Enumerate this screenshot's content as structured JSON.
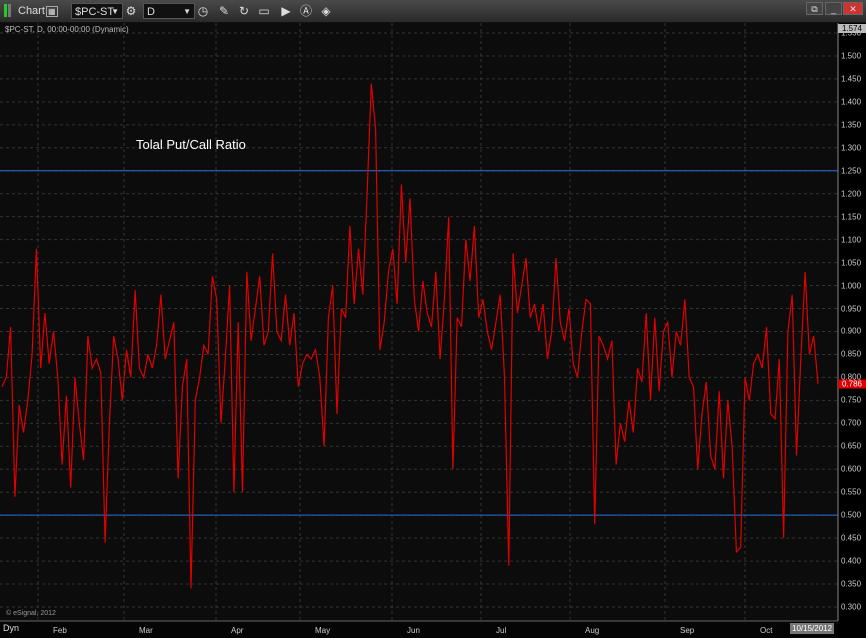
{
  "window": {
    "title": "Chart",
    "symbol": "$PC-ST",
    "interval": "D"
  },
  "legend": "$PC-ST, D, 00:00-00:00 (Dynamic)",
  "copyright": "© eSignal, 2012",
  "dyn_label": "Dyn",
  "colors": {
    "line": "#e00000",
    "hline": "#2b6fd6",
    "bg": "#0c0c0c"
  },
  "chart_data": {
    "type": "line",
    "title": "Tolal Put/Call Ratio",
    "xlabel": "",
    "ylabel": "",
    "ylim": [
      0.3,
      1.55
    ],
    "yticks": [
      "1.550",
      "1.500",
      "1.450",
      "1.400",
      "1.350",
      "1.300",
      "1.250",
      "1.200",
      "1.150",
      "1.100",
      "1.050",
      "1.000",
      "0.950",
      "0.900",
      "0.850",
      "0.800",
      "0.750",
      "0.700",
      "0.650",
      "0.600",
      "0.550",
      "0.500",
      "0.450",
      "0.400",
      "0.350",
      "0.300"
    ],
    "xticks": [
      "Feb",
      "Mar",
      "Apr",
      "May",
      "Jun",
      "Jul",
      "Aug",
      "Sep",
      "Oct"
    ],
    "current_date": "10/15/2012",
    "top_value": "1.574",
    "last_value": "0.786",
    "hlines": [
      1.25,
      0.5
    ],
    "series": [
      {
        "name": "$PC-ST",
        "values": [
          0.78,
          0.8,
          0.91,
          0.54,
          0.74,
          0.68,
          0.75,
          0.85,
          1.08,
          0.82,
          0.94,
          0.83,
          0.9,
          0.8,
          0.61,
          0.76,
          0.56,
          0.8,
          0.7,
          0.62,
          0.89,
          0.82,
          0.84,
          0.81,
          0.44,
          0.7,
          0.89,
          0.84,
          0.75,
          0.86,
          0.8,
          0.99,
          0.82,
          0.8,
          0.85,
          0.82,
          0.87,
          0.98,
          0.84,
          0.88,
          0.92,
          0.58,
          0.78,
          0.84,
          0.34,
          0.75,
          0.8,
          0.87,
          0.85,
          1.02,
          0.97,
          0.7,
          0.84,
          1.0,
          0.55,
          0.92,
          0.55,
          1.03,
          0.88,
          0.95,
          1.02,
          0.87,
          0.9,
          1.07,
          0.9,
          0.88,
          0.98,
          0.87,
          0.94,
          0.78,
          0.83,
          0.85,
          0.84,
          0.86,
          0.8,
          0.65,
          0.93,
          1.0,
          0.72,
          0.95,
          0.93,
          1.13,
          0.96,
          1.08,
          0.98,
          1.2,
          1.44,
          1.34,
          0.86,
          0.92,
          1.03,
          1.08,
          0.96,
          1.22,
          1.05,
          1.19,
          0.97,
          0.9,
          1.01,
          0.94,
          0.91,
          1.03,
          0.84,
          0.97,
          1.15,
          0.6,
          0.93,
          0.91,
          1.1,
          1.01,
          1.13,
          0.93,
          0.97,
          0.9,
          0.86,
          0.92,
          0.98,
          0.8,
          0.39,
          1.07,
          0.94,
          1.0,
          1.06,
          0.93,
          0.96,
          0.9,
          0.96,
          0.84,
          0.9,
          1.06,
          0.92,
          0.88,
          0.95,
          0.83,
          0.8,
          0.9,
          0.97,
          0.96,
          0.48,
          0.89,
          0.87,
          0.84,
          0.88,
          0.61,
          0.7,
          0.66,
          0.75,
          0.68,
          0.82,
          0.79,
          0.94,
          0.75,
          0.93,
          0.77,
          0.9,
          0.92,
          0.8,
          0.9,
          0.87,
          0.97,
          0.8,
          0.78,
          0.6,
          0.72,
          0.79,
          0.63,
          0.6,
          0.77,
          0.58,
          0.75,
          0.65,
          0.42,
          0.43,
          0.8,
          0.75,
          0.83,
          0.85,
          0.82,
          0.91,
          0.72,
          0.71,
          0.84,
          0.45,
          0.9,
          0.98,
          0.63,
          0.84,
          1.03,
          0.85,
          0.89,
          0.786
        ]
      }
    ]
  }
}
